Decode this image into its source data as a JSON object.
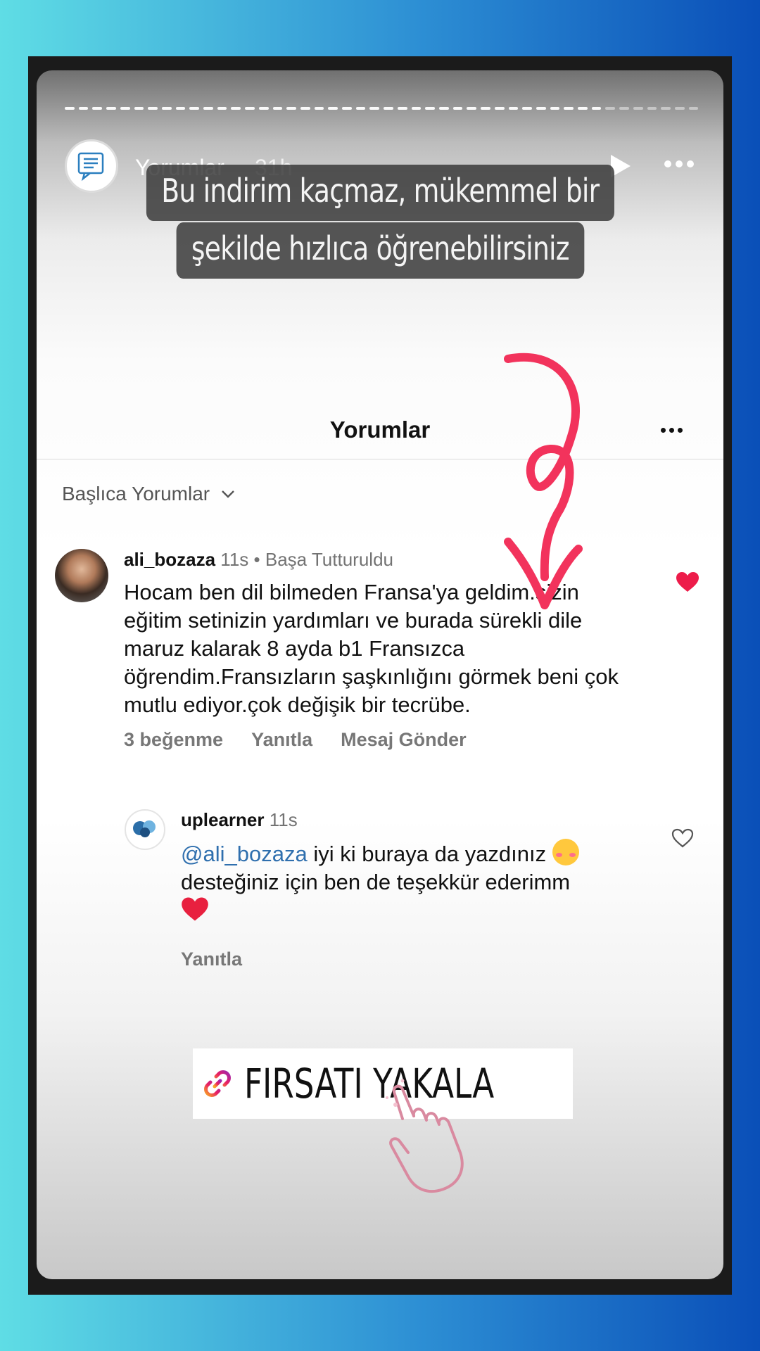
{
  "story": {
    "title": "Yorumlar",
    "time": "31h",
    "caption_line1": "Bu indirim kaçmaz, mükemmel bir",
    "caption_line2": "şekilde hızlıca öğrenebilirsiniz"
  },
  "comments_panel": {
    "title": "Yorumlar",
    "sort_label": "Başlıca Yorumlar"
  },
  "comment1": {
    "username": "ali_bozaza",
    "time": "11s",
    "pinned": "Başa Tutturuldu",
    "text": "Hocam ben dil bilmeden Fransa'ya geldim.sizin eğitim setinizin yardımları ve burada sürekli dile maruz kalarak 8 ayda b1 Fransızca öğrendim.Fransızların şaşkınlığını görmek beni çok mutlu ediyor.çok değişik bir tecrübe.",
    "likes": "3 beğenme",
    "reply": "Yanıtla",
    "message": "Mesaj Gönder",
    "liked": true
  },
  "comment2": {
    "username": "uplearner",
    "time": "11s",
    "mention": "@ali_bozaza",
    "text_part1": " iyi ki buraya da yazdınız ",
    "text_part2": " desteğiniz için ben de teşekkür ederimm",
    "reply": "Yanıtla",
    "liked": false
  },
  "sticker": {
    "label": "FIRSATI YAKALA",
    "icon": "link-icon"
  },
  "colors": {
    "heart": "#ed1c4a",
    "mention": "#2f6fae",
    "arrow": "#f2335c"
  }
}
